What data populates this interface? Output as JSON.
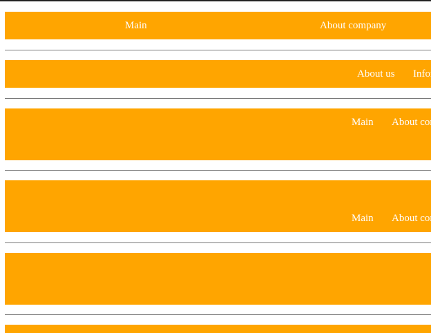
{
  "colors": {
    "bar": "#ffa500",
    "link": "#ffffff",
    "rule": "#777777"
  },
  "navbars": [
    {
      "links": [
        "Main",
        "About company"
      ]
    },
    {
      "links": [
        "About us",
        "Infor"
      ]
    },
    {
      "links": [
        "Main",
        "About cor"
      ]
    },
    {
      "links": [
        "Main",
        "About cor"
      ]
    },
    {
      "links": []
    },
    {
      "links": []
    }
  ]
}
